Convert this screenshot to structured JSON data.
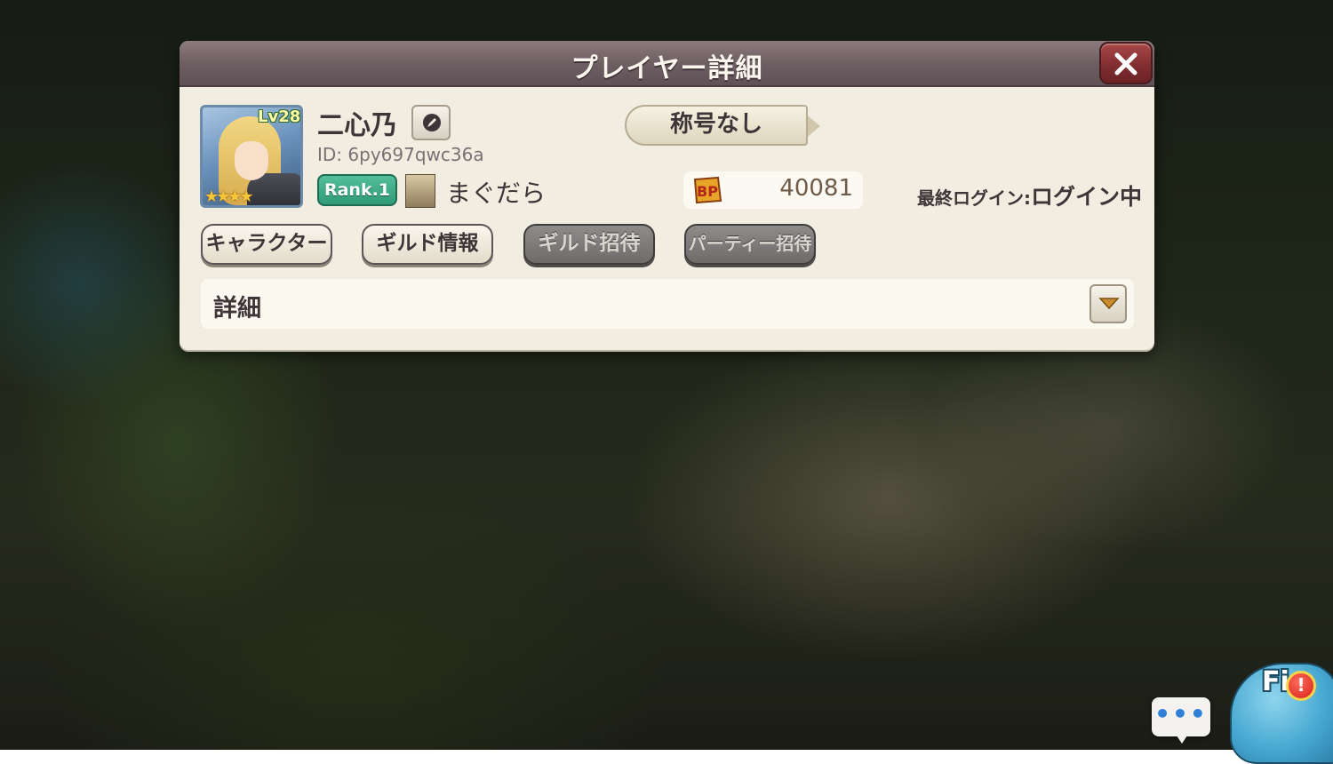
{
  "dialog": {
    "title": "プレイヤー詳細"
  },
  "player": {
    "level": "Lv28",
    "stars": "★★★★",
    "name": "二心乃",
    "id": "ID: 6py697qwc36a",
    "rank": "Rank.1",
    "guild_name": "まぐだら",
    "title_plate": "称号なし",
    "bp_label": "BP",
    "bp_value": "40081",
    "last_login_label": "最終ログイン:",
    "last_login_value": "ログイン中"
  },
  "actions": {
    "character": "キャラクター",
    "guild_info": "ギルド情報",
    "guild_invite": "ギルド招待",
    "party_invite": "パーティー招待"
  },
  "details": {
    "label": "詳細"
  },
  "hud": {
    "chat_dots": "•••",
    "field_label": "Fi",
    "alert": "!"
  },
  "colors": {
    "header": "#6e5f63",
    "panel": "#f1ede0",
    "close": "#8f3336",
    "rank_badge": "#3aa882",
    "disabled_button": "#7d7b79"
  }
}
